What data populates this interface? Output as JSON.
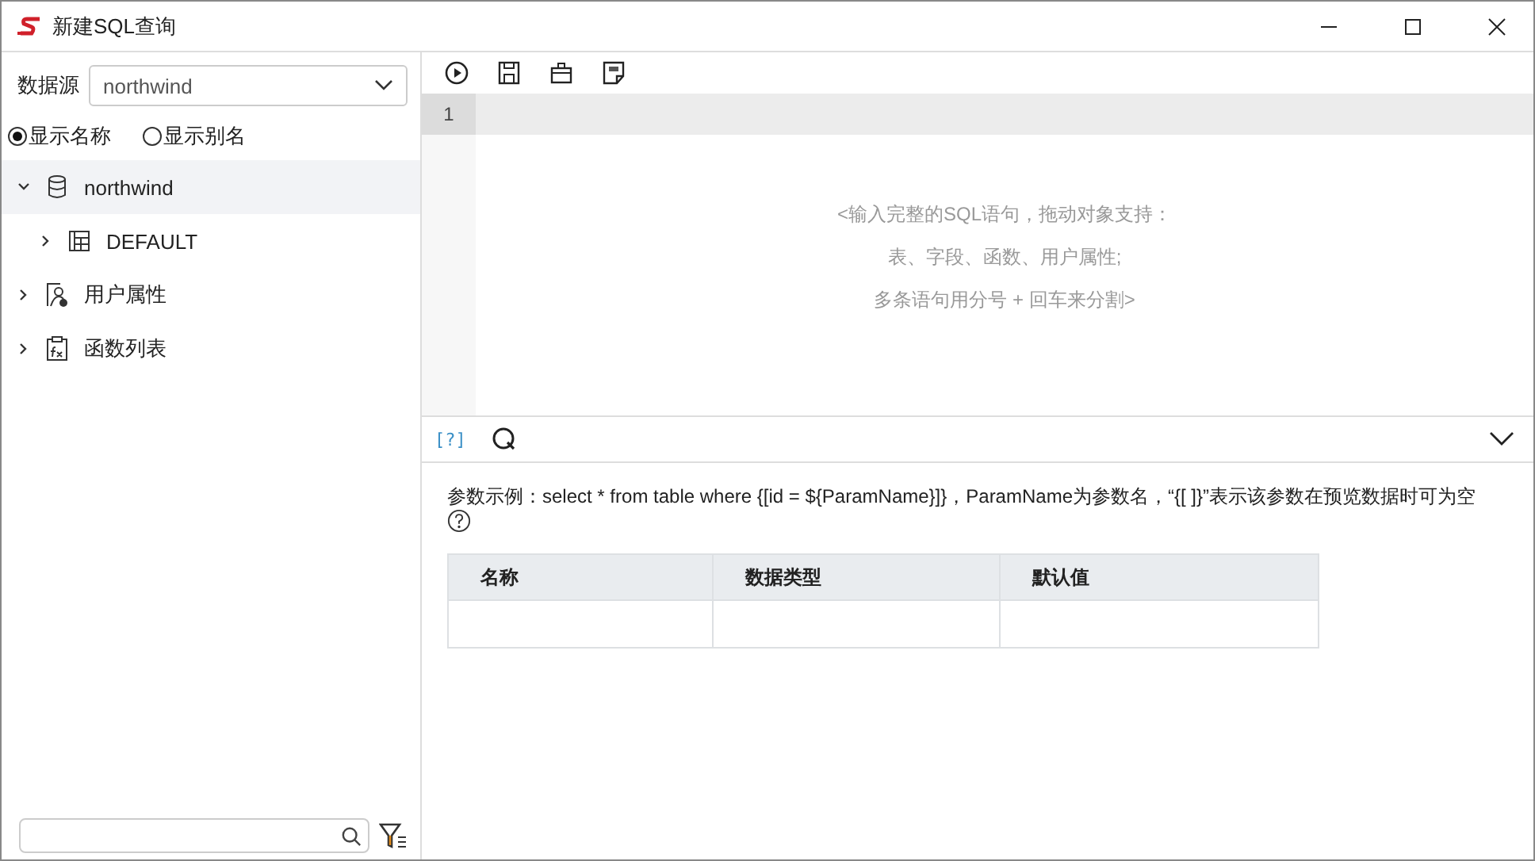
{
  "window": {
    "title": "新建SQL查询"
  },
  "datasource": {
    "label": "数据源",
    "value": "northwind"
  },
  "display_options": [
    {
      "label": "显示名称",
      "selected": true
    },
    {
      "label": "显示别名",
      "selected": false
    }
  ],
  "tree": [
    {
      "label": "northwind",
      "kind": "database",
      "expanded": true,
      "selected": true,
      "children": [
        {
          "label": "DEFAULT",
          "kind": "schema",
          "expanded": false,
          "selected": false
        }
      ]
    },
    {
      "label": "用户属性",
      "kind": "user",
      "expanded": false,
      "selected": false
    },
    {
      "label": "函数列表",
      "kind": "function",
      "expanded": false,
      "selected": false
    }
  ],
  "editor": {
    "line_numbers": [
      "1"
    ],
    "placeholder": [
      "<输入完整的SQL语句，拖动对象支持：",
      "表、字段、函数、用户属性;",
      "多条语句用分号 + 回车来分割>"
    ]
  },
  "param_toolbar": {
    "help_label": "[?]"
  },
  "param_hint": "参数示例：select * from table where {[id = ${ParamName}]}，ParamName为参数名，“{[ ]}”表示该参数在预览数据时可为空",
  "param_table": {
    "columns": [
      "名称",
      "数据类型",
      "默认值"
    ]
  }
}
